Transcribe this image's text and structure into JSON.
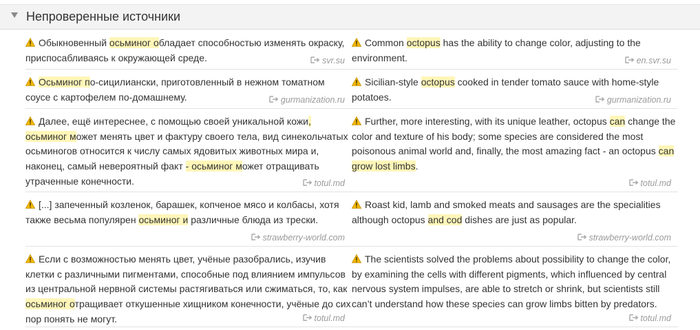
{
  "section": {
    "title": "Непроверенные источники"
  },
  "rows": [
    {
      "ru": [
        {
          "t": "Обыкновенный "
        },
        {
          "t": "осьминог о",
          "h": true
        },
        {
          "t": "бладает способностью изменять окраску, приспосабливаясь к окружающей среде."
        }
      ],
      "ru_source": "svr.su",
      "en": [
        {
          "t": "Common "
        },
        {
          "t": "octopus",
          "h": true
        },
        {
          "t": " has the ability to change color, adjusting to the environment."
        }
      ],
      "en_source": "en.svr.su"
    },
    {
      "ru": [
        {
          "t": "Осьминог п",
          "h": true
        },
        {
          "t": "о-сицилиански, приготовленный в нежном томатном соусе с картофелем по-домашнему."
        }
      ],
      "ru_source": "gurmanization.ru",
      "en": [
        {
          "t": "Sicilian-style "
        },
        {
          "t": "octopus",
          "h": true
        },
        {
          "t": " cooked in tender tomato sauce with home-style potatoes."
        }
      ],
      "en_source": "gurmanization.ru"
    },
    {
      "ru": [
        {
          "t": "Далее, ещё интереснее, с помощью своей уникальной кожи"
        },
        {
          "t": ", осьминог м",
          "h": true
        },
        {
          "t": "ожет менять цвет и фактуру своего тела, вид синекольчатых осьминогов относится к числу самых ядовитых животных мира и, наконец, самый невероятный факт "
        },
        {
          "t": "- осьминог м",
          "h": true
        },
        {
          "t": "ожет отращивать утраченные конечности."
        }
      ],
      "ru_source": "totul.md",
      "en": [
        {
          "t": "Further, more interesting, with its unique leather, octopus "
        },
        {
          "t": "can",
          "h": true
        },
        {
          "t": " change the color and texture of his body; some species are considered the most poisonous animal world and, finally, the most amazing fact - an octopus "
        },
        {
          "t": "can grow lost limbs",
          "h": true
        },
        {
          "t": "."
        }
      ],
      "en_source": "totul.md"
    },
    {
      "ru": [
        {
          "t": "[...] запеченный козленок, барашек, копченое мясо и колбасы, хотя также весьма популярен "
        },
        {
          "t": "осьминог и",
          "h": true
        },
        {
          "t": " различные блюда из трески."
        }
      ],
      "ru_source": "strawberry-world.com",
      "en": [
        {
          "t": "Roast kid, lamb and smoked meats and sausages are the specialities although octopus "
        },
        {
          "t": "and cod",
          "h": true
        },
        {
          "t": " dishes are just as popular."
        }
      ],
      "en_source": "strawberry-world.com"
    },
    {
      "ru": [
        {
          "t": "Если с возможностью менять цвет, учёные разобрались, изучив клетки с различными пигментами, способные под влиянием импульсов из центральной нервной системы растягиваться или сжиматься, то, как "
        },
        {
          "t": "осьминог о",
          "h": true
        },
        {
          "t": "тращивает откушенные хищником конечности, учёные до сих пор понять не могут."
        }
      ],
      "ru_source": "totul.md",
      "en": [
        {
          "t": "The scientists solved the problems about possibility to change the color, by examining the cells with different pigments, which influenced by central nervous system impulses, are able to stretch or shrink, but scientists still can’t understand how these species can grow limbs bitten by predators."
        }
      ],
      "en_source": "totul.md"
    }
  ],
  "icons": {
    "warning": "warning-icon",
    "source": "external-link-icon",
    "collapse": "collapse-triangle-icon"
  },
  "colors": {
    "highlight": "#fff6b8",
    "header_bg": "#f3f3f3",
    "source_text": "#9a9a9a"
  }
}
